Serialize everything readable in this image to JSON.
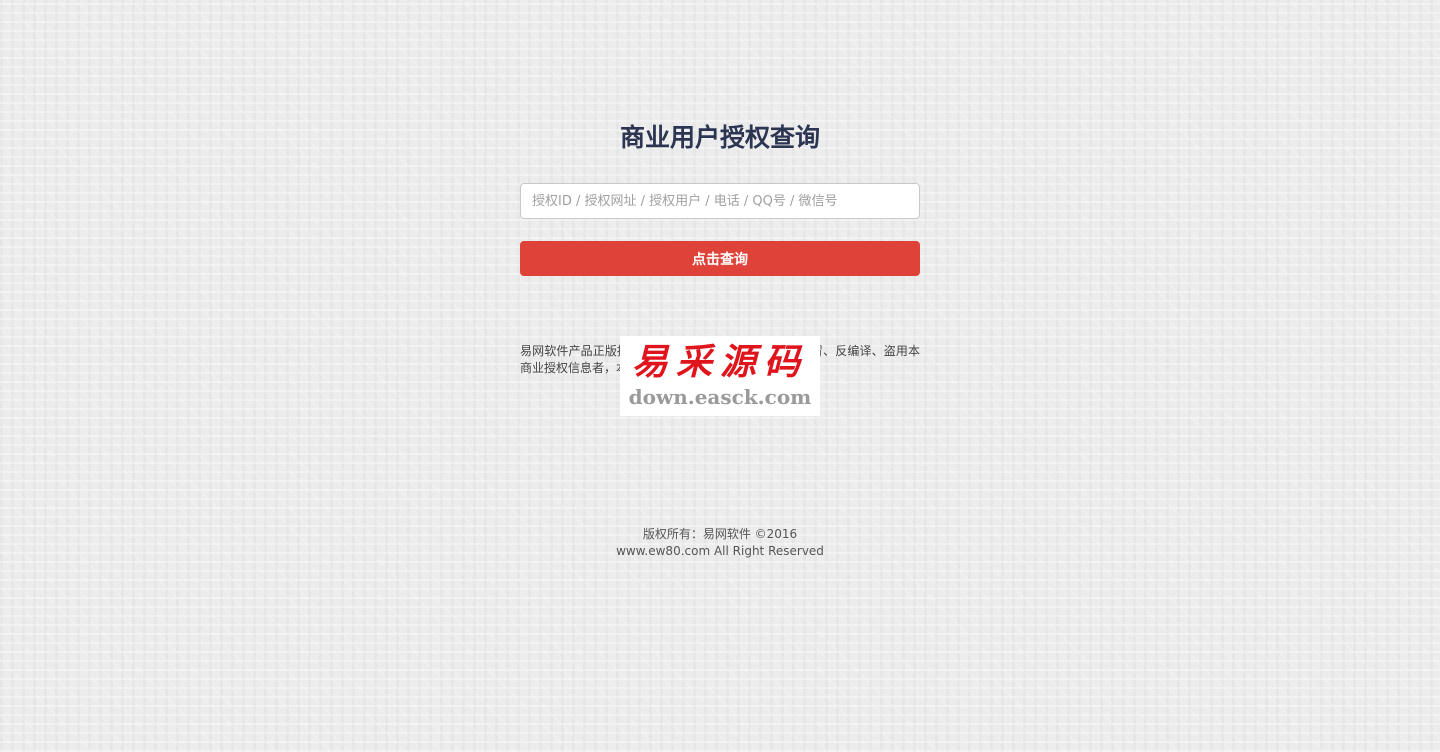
{
  "page": {
    "title": "商业用户授权查询"
  },
  "search": {
    "placeholder": "授权ID / 授权网址 / 授权用户 / 电话 / QQ号 / 微信号",
    "value": "",
    "button_label": "点击查询"
  },
  "notice": {
    "text": "易网软件产品正版授权查询，请认准官方授权，谨防仿冒、反编译、盗用本商业授权信息者，本公司将保留追究其法律责任的权利!"
  },
  "watermark": {
    "logo_text": "易采源码",
    "url": "down.easck.com"
  },
  "footer": {
    "copyright": "版权所有：易网软件 ©2016",
    "rights": "www.ew80.com All Right Reserved"
  },
  "colors": {
    "background": "#ececec",
    "title": "#2c3552",
    "button": "#df4239",
    "watermark_red": "#e0141c"
  }
}
